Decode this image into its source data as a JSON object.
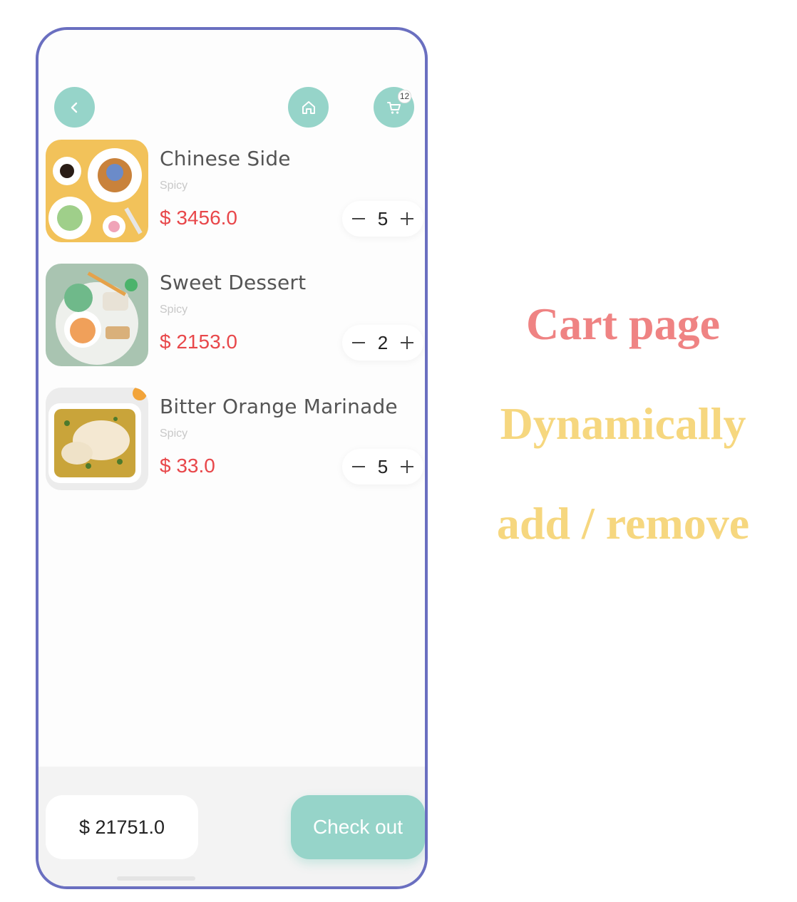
{
  "header": {
    "back_icon": "chevron-left-icon",
    "home_icon": "home-icon",
    "cart_icon": "cart-icon",
    "cart_badge": "12",
    "button_color": "#96d4c9"
  },
  "cart": {
    "items": [
      {
        "name": "Chinese Side",
        "tag": "Spicy",
        "price": "$ 3456.0",
        "quantity": "5"
      },
      {
        "name": "Sweet Dessert",
        "tag": "Spicy",
        "price": "$ 2153.0",
        "quantity": "2"
      },
      {
        "name": "Bitter Orange Marinade",
        "tag": "Spicy",
        "price": "$ 33.0",
        "quantity": "5"
      }
    ]
  },
  "footer": {
    "total": "$ 21751.0",
    "checkout_label": "Check out"
  },
  "promo": {
    "line1": "Cart page",
    "line2": "Dynamically",
    "line3": "add / remove",
    "colors": {
      "line1": "#ef8383",
      "line2": "#f6d77f",
      "line3": "#f6d77f"
    }
  },
  "colors": {
    "price": "#e8474a",
    "phone_border": "#6a6fc0"
  }
}
